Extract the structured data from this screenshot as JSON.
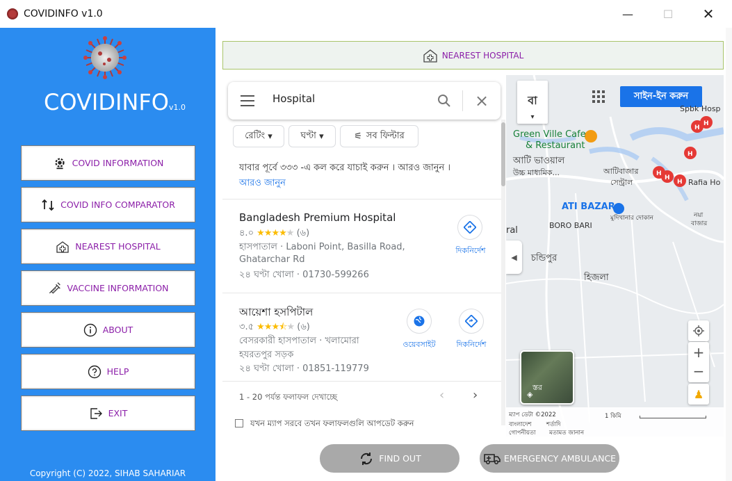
{
  "window": {
    "title": "COVIDINFO v1.0",
    "minimize": "—",
    "maximize": "☐",
    "close": "✕"
  },
  "sidebar": {
    "brand": "COVIDINFO",
    "brand_version": "v1.0",
    "items": [
      {
        "label": "COVID INFORMATION",
        "icon": "gear-virus-icon"
      },
      {
        "label": "COVID INFO COMPARATOR",
        "icon": "compare-icon"
      },
      {
        "label": "NEAREST HOSPITAL",
        "icon": "hospital-icon"
      },
      {
        "label": "VACCINE INFORMATION",
        "icon": "syringe-icon"
      },
      {
        "label": "ABOUT",
        "icon": "info-icon"
      },
      {
        "label": "HELP",
        "icon": "help-icon"
      },
      {
        "label": "EXIT",
        "icon": "exit-icon"
      }
    ],
    "copyright": "Copyright (C) 2022, SIHAB SAHARIAR"
  },
  "header": {
    "title": "NEAREST HOSPITAL"
  },
  "maps_panel": {
    "search_value": "Hospital",
    "filters": [
      "রেটিং",
      "ঘণ্টা",
      "সব ফিল্টার"
    ],
    "notice": "যাবার পূর্বে ৩৩৩ -এ কল করে যাচাই করুন । আরও জানুন ।",
    "notice_link": "আরও জানুন",
    "results": [
      {
        "name": "Bangladesh Premium Hospital",
        "rating": "৪.০",
        "reviews": "(৬)",
        "line1": "হাসপাতাল · Laboni Point, Basilla Road,",
        "line2": "Ghatarchar Rd",
        "hours": "২৪ ঘণ্টা খোলা · 01730-599266",
        "directions": "দিকনির্দেশ"
      },
      {
        "name": "আয়েশা হসপিটাল",
        "rating": "৩.৫",
        "reviews": "(৬)",
        "line1": "বেসরকারী হাসপাতাল · খলামোরা",
        "line2": "হযরতপুর সড়ক",
        "hours": "২৪ ঘণ্টা খোলা · 01851-119779",
        "website": "ওয়েবসাইট",
        "directions": "দিকনির্দেশ"
      }
    ],
    "paging": "1 - 20 পর্যন্ত ফলাফল দেখাচ্ছে",
    "update_checkbox": "যখন ম্যাপ সরবে তখন ফলাফলগুলি আপডেট করুন"
  },
  "map": {
    "lang": "বা",
    "signin": "সাইন-ইন করুন",
    "labels": {
      "spbk": "Spbk Hosp",
      "green_ville": "Green Ville Cafe",
      "restaurant": "& Restaurant",
      "ati_bhaoyal": "আটি ভাওয়াল",
      "uchcha": "উচ্চ মাধ্যমিক...",
      "atibazar": "আটিবাজার",
      "central": "সেন্ট্রাল",
      "rafia": "Rafia Ho",
      "naya": "নয়া",
      "bazar": "বাজার",
      "ati_bazar": "ATI BAZAR",
      "mudikhana": "মুদিখানার দোকান",
      "boro_bari": "BORO BARI",
      "ral": "ral",
      "chandipur": "চন্ডিপুর",
      "hijla": "হিজলা",
      "layer": "স্তর"
    },
    "footer": {
      "data": "ম্যাপ ডেটা ©2022",
      "scale": "1 কিমি",
      "bangladesh": "বাংলাদেশ",
      "terms": "শর্তাদি",
      "privacy": "গোপনীয়তা",
      "feedback": "মতামত জানান"
    }
  },
  "actions": {
    "find_out": "FIND OUT",
    "ambulance": "EMERGENCY AMBULANCE"
  },
  "colors": {
    "sidebar": "#2b8cf0",
    "menu_text": "#8b1ea8",
    "button_gray": "#a9a9a9",
    "link_blue": "#1a73e8"
  }
}
